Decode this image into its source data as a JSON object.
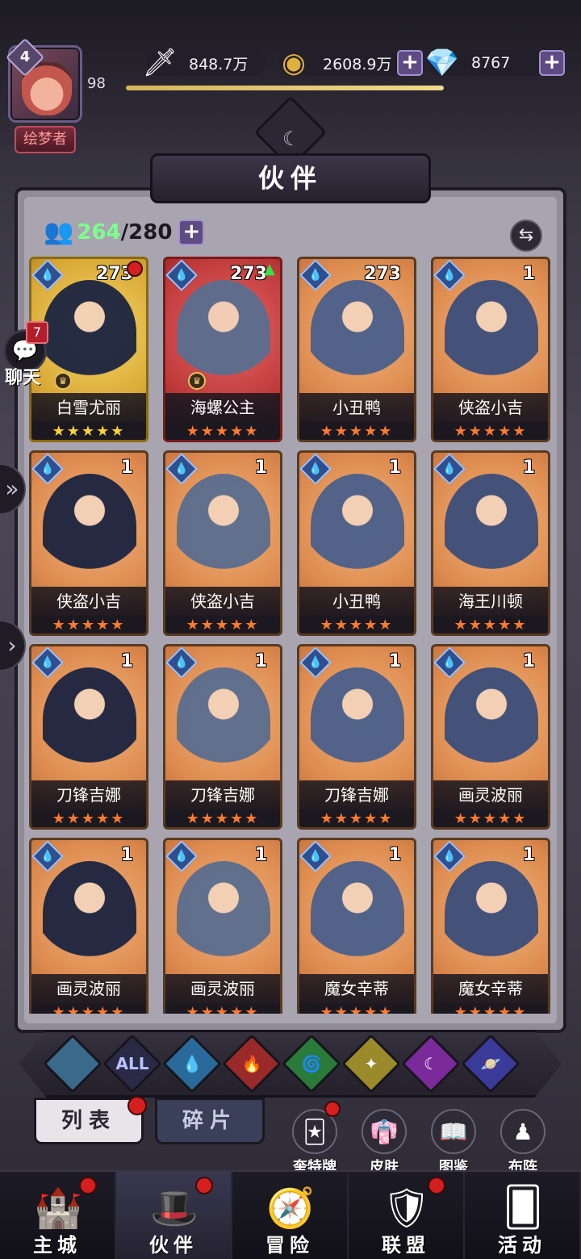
{
  "player": {
    "level": "4",
    "level_progress": "98",
    "title": "绘梦者",
    "xp_fraction": 0.73
  },
  "currencies": [
    {
      "icon": "sword-power-icon",
      "value": "848.7万",
      "has_plus": false
    },
    {
      "icon": "gold-coin-icon",
      "value": "2608.9万",
      "has_plus": true
    },
    {
      "icon": "diamond-icon",
      "value": "8767",
      "has_plus": true
    }
  ],
  "header": {
    "title": "伙伴"
  },
  "roster": {
    "current": "264",
    "separator": "/",
    "max": "280"
  },
  "chat": {
    "label": "聊天",
    "unread": "7"
  },
  "cards": [
    {
      "name": "白雪尤丽",
      "level": "273",
      "stars": "★★★★★",
      "style": "gold",
      "dot": true,
      "arrow": false,
      "crown": true
    },
    {
      "name": "海螺公主",
      "level": "273",
      "stars": "★★★★★",
      "style": "red",
      "dot": false,
      "arrow": true,
      "crown": true
    },
    {
      "name": "小丑鸭",
      "level": "273",
      "stars": "★★★★★",
      "style": "orange",
      "dot": false,
      "arrow": false,
      "crown": false
    },
    {
      "name": "侠盗小吉",
      "level": "1",
      "stars": "★★★★★",
      "style": "orange",
      "dot": false,
      "arrow": false,
      "crown": false
    },
    {
      "name": "侠盗小吉",
      "level": "1",
      "stars": "★★★★★",
      "style": "orange",
      "dot": false,
      "arrow": false,
      "crown": false
    },
    {
      "name": "侠盗小吉",
      "level": "1",
      "stars": "★★★★★",
      "style": "orange",
      "dot": false,
      "arrow": false,
      "crown": false
    },
    {
      "name": "小丑鸭",
      "level": "1",
      "stars": "★★★★★",
      "style": "orange",
      "dot": false,
      "arrow": false,
      "crown": false
    },
    {
      "name": "海王川顿",
      "level": "1",
      "stars": "★★★★★",
      "style": "orange",
      "dot": false,
      "arrow": false,
      "crown": false
    },
    {
      "name": "刀锋吉娜",
      "level": "1",
      "stars": "★★★★★",
      "style": "orange",
      "dot": false,
      "arrow": false,
      "crown": false
    },
    {
      "name": "刀锋吉娜",
      "level": "1",
      "stars": "★★★★★",
      "style": "orange",
      "dot": false,
      "arrow": false,
      "crown": false
    },
    {
      "name": "刀锋吉娜",
      "level": "1",
      "stars": "★★★★★",
      "style": "orange",
      "dot": false,
      "arrow": false,
      "crown": false
    },
    {
      "name": "画灵波丽",
      "level": "1",
      "stars": "★★★★★",
      "style": "orange",
      "dot": false,
      "arrow": false,
      "crown": false
    },
    {
      "name": "画灵波丽",
      "level": "1",
      "stars": "★★★★★",
      "style": "orange",
      "dot": false,
      "arrow": false,
      "crown": false
    },
    {
      "name": "画灵波丽",
      "level": "1",
      "stars": "★★★★★",
      "style": "orange",
      "dot": false,
      "arrow": false,
      "crown": false
    },
    {
      "name": "魔女辛蒂",
      "level": "1",
      "stars": "★★★★★",
      "style": "orange",
      "dot": false,
      "arrow": false,
      "crown": false
    },
    {
      "name": "魔女辛蒂",
      "level": "1",
      "stars": "★★★★★",
      "style": "orange",
      "dot": false,
      "arrow": false,
      "crown": false
    }
  ],
  "filters": [
    {
      "name": "filter-default-icon",
      "label": "",
      "color": "#3a6a8a"
    },
    {
      "name": "filter-all",
      "label": "ALL",
      "color": "#2a2a46"
    },
    {
      "name": "filter-water-icon",
      "label": "💧",
      "color": "#2a6a9a"
    },
    {
      "name": "filter-fire-icon",
      "label": "🔥",
      "color": "#9a2a2a"
    },
    {
      "name": "filter-wind-icon",
      "label": "🌀",
      "color": "#2a7a3a"
    },
    {
      "name": "filter-light-icon",
      "label": "✦",
      "color": "#9a8a2a"
    },
    {
      "name": "filter-dark-icon",
      "label": "☾",
      "color": "#7a2a9a"
    },
    {
      "name": "filter-cosmic-icon",
      "label": "🪐",
      "color": "#3a3a9a"
    }
  ],
  "tabs": {
    "list": "列表",
    "fragments": "碎片"
  },
  "side_buttons": [
    {
      "label": "奎特牌",
      "icon": "card-deck-icon",
      "dot": true
    },
    {
      "label": "皮肤",
      "icon": "outfit-icon",
      "dot": false
    },
    {
      "label": "图鉴",
      "icon": "codex-icon",
      "dot": false
    },
    {
      "label": "布阵",
      "icon": "formation-icon",
      "dot": false
    }
  ],
  "nav": [
    {
      "label": "主城",
      "icon": "castle-icon",
      "dot": true,
      "active": false
    },
    {
      "label": "伙伴",
      "icon": "witch-hat-icon",
      "dot": true,
      "active": true
    },
    {
      "label": "冒险",
      "icon": "compass-icon",
      "dot": false,
      "active": false
    },
    {
      "label": "联盟",
      "icon": "shield-icon",
      "dot": true,
      "active": false
    },
    {
      "label": "活动",
      "icon": "cards-icon",
      "dot": false,
      "active": false
    }
  ]
}
